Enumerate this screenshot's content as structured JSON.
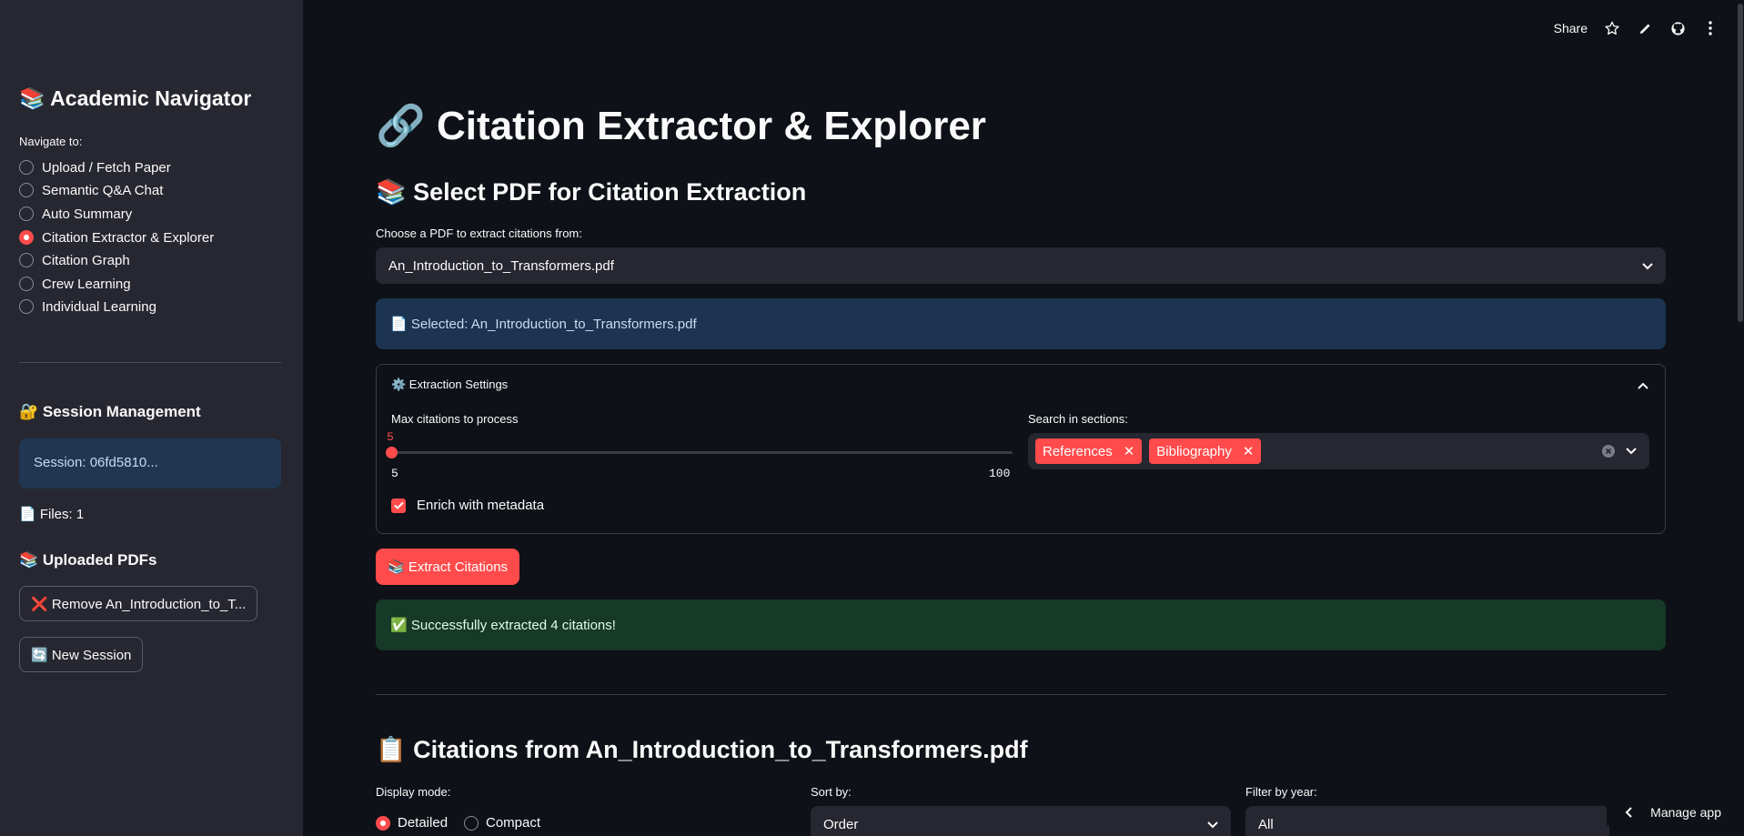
{
  "sidebar": {
    "title": "📚 Academic Navigator",
    "nav_label": "Navigate to:",
    "nav_items": [
      {
        "label": "Upload / Fetch Paper",
        "selected": false
      },
      {
        "label": "Semantic Q&A Chat",
        "selected": false
      },
      {
        "label": "Auto Summary",
        "selected": false
      },
      {
        "label": "Citation Extractor & Explorer",
        "selected": true
      },
      {
        "label": "Citation Graph",
        "selected": false
      },
      {
        "label": "Crew Learning",
        "selected": false
      },
      {
        "label": "Individual Learning",
        "selected": false
      }
    ],
    "session_heading": "🔐 Session Management",
    "session_text": "Session: 06fd5810...",
    "files_text": "📄 Files: 1",
    "uploaded_heading": "📚 Uploaded PDFs",
    "remove_button": "❌ Remove An_Introduction_to_T...",
    "new_session_button": "🔄 New Session"
  },
  "toolbar": {
    "share_label": "Share",
    "icons": [
      "star-icon",
      "edit-icon",
      "github-icon",
      "more-icon"
    ]
  },
  "main": {
    "title": "🔗 Citation Extractor & Explorer",
    "select_heading": "📚 Select PDF for Citation Extraction",
    "choose_label": "Choose a PDF to extract citations from:",
    "selected_pdf": "An_Introduction_to_Transformers.pdf",
    "selected_info": "📄 Selected: An_Introduction_to_Transformers.pdf",
    "expander": {
      "title": "⚙️ Extraction Settings",
      "max_label": "Max citations to process",
      "slider_value": "5",
      "slider_min": "5",
      "slider_max": "100",
      "sections_label": "Search in sections:",
      "sections": [
        "References",
        "Bibliography"
      ],
      "enrich_label": "Enrich with metadata",
      "enrich_checked": true
    },
    "extract_button": "📚 Extract Citations",
    "success_message": "✅ Successfully extracted 4 citations!",
    "citations_heading": "📋 Citations from An_Introduction_to_Transformers.pdf",
    "display_mode_label": "Display mode:",
    "display_modes": [
      {
        "label": "Detailed",
        "selected": true
      },
      {
        "label": "Compact",
        "selected": false
      }
    ],
    "sort_label": "Sort by:",
    "sort_value": "Order",
    "filter_label": "Filter by year:",
    "filter_value": "All"
  },
  "manage_app": "Manage app",
  "colors": {
    "accent": "#ff4b4b",
    "background": "#0e1117",
    "sidebar": "#262730",
    "info": "#1c3450",
    "success": "#173928"
  }
}
